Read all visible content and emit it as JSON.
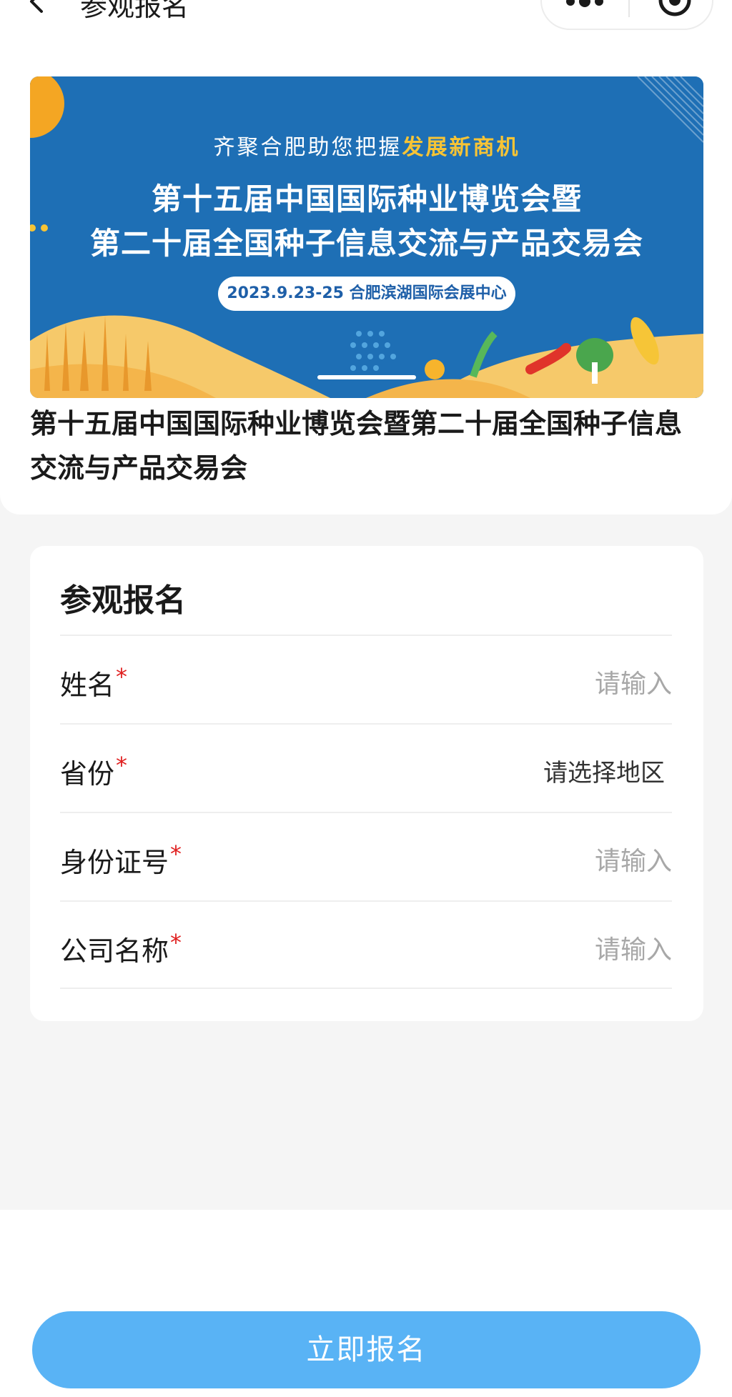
{
  "nav": {
    "title": "参观报名"
  },
  "banner": {
    "subtitle_pre": "齐聚合肥助您把握",
    "subtitle_highlight": "发展新商机",
    "title_line1": "第十五届中国国际种业博览会暨",
    "title_line2": "第二十届全国种子信息交流与产品交易会",
    "date_venue": "2023.9.23-25  合肥滨湖国际会展中心"
  },
  "event": {
    "title": "第十五届中国国际种业博览会暨第二十届全国种子信息交流与产品交易会"
  },
  "form": {
    "title": "参观报名",
    "fields": [
      {
        "label": "姓名",
        "required_mark": "*",
        "placeholder": "请输入"
      },
      {
        "label": "省份",
        "required_mark": "*",
        "placeholder": "请选择地区"
      },
      {
        "label": "身份证号",
        "required_mark": "*",
        "placeholder": "请输入"
      },
      {
        "label": "公司名称",
        "required_mark": "*",
        "placeholder": "请输入"
      }
    ]
  },
  "actions": {
    "submit_label": "立即报名"
  },
  "colors": {
    "accent": "#59b3f5",
    "required": "#e02020",
    "banner_bg": "#1e6fb5",
    "banner_highlight": "#f7c435"
  },
  "icons": [
    "back-icon",
    "more-icon",
    "close-icon"
  ]
}
